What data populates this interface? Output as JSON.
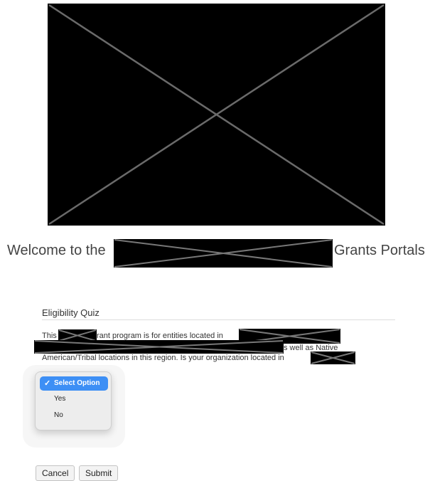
{
  "header": {
    "welcome_prefix": "Welcome to the",
    "welcome_suffix": "Grants Portals"
  },
  "quiz": {
    "title": "Eligibility Quiz",
    "question": {
      "line1_a": "This",
      "line1_b": "rant program is for entities located in",
      "line2_end": "s well as Native",
      "line3": "American/Tribal locations in this region. Is your organization located in"
    },
    "select": {
      "options": [
        {
          "label": "Select Option",
          "selected": true
        },
        {
          "label": "Yes",
          "selected": false
        },
        {
          "label": "No",
          "selected": false
        }
      ]
    }
  },
  "actions": {
    "cancel_label": "Cancel",
    "submit_label": "Submit"
  },
  "colors": {
    "selection_accent": "#3d8ff5",
    "redaction": "#000000"
  }
}
